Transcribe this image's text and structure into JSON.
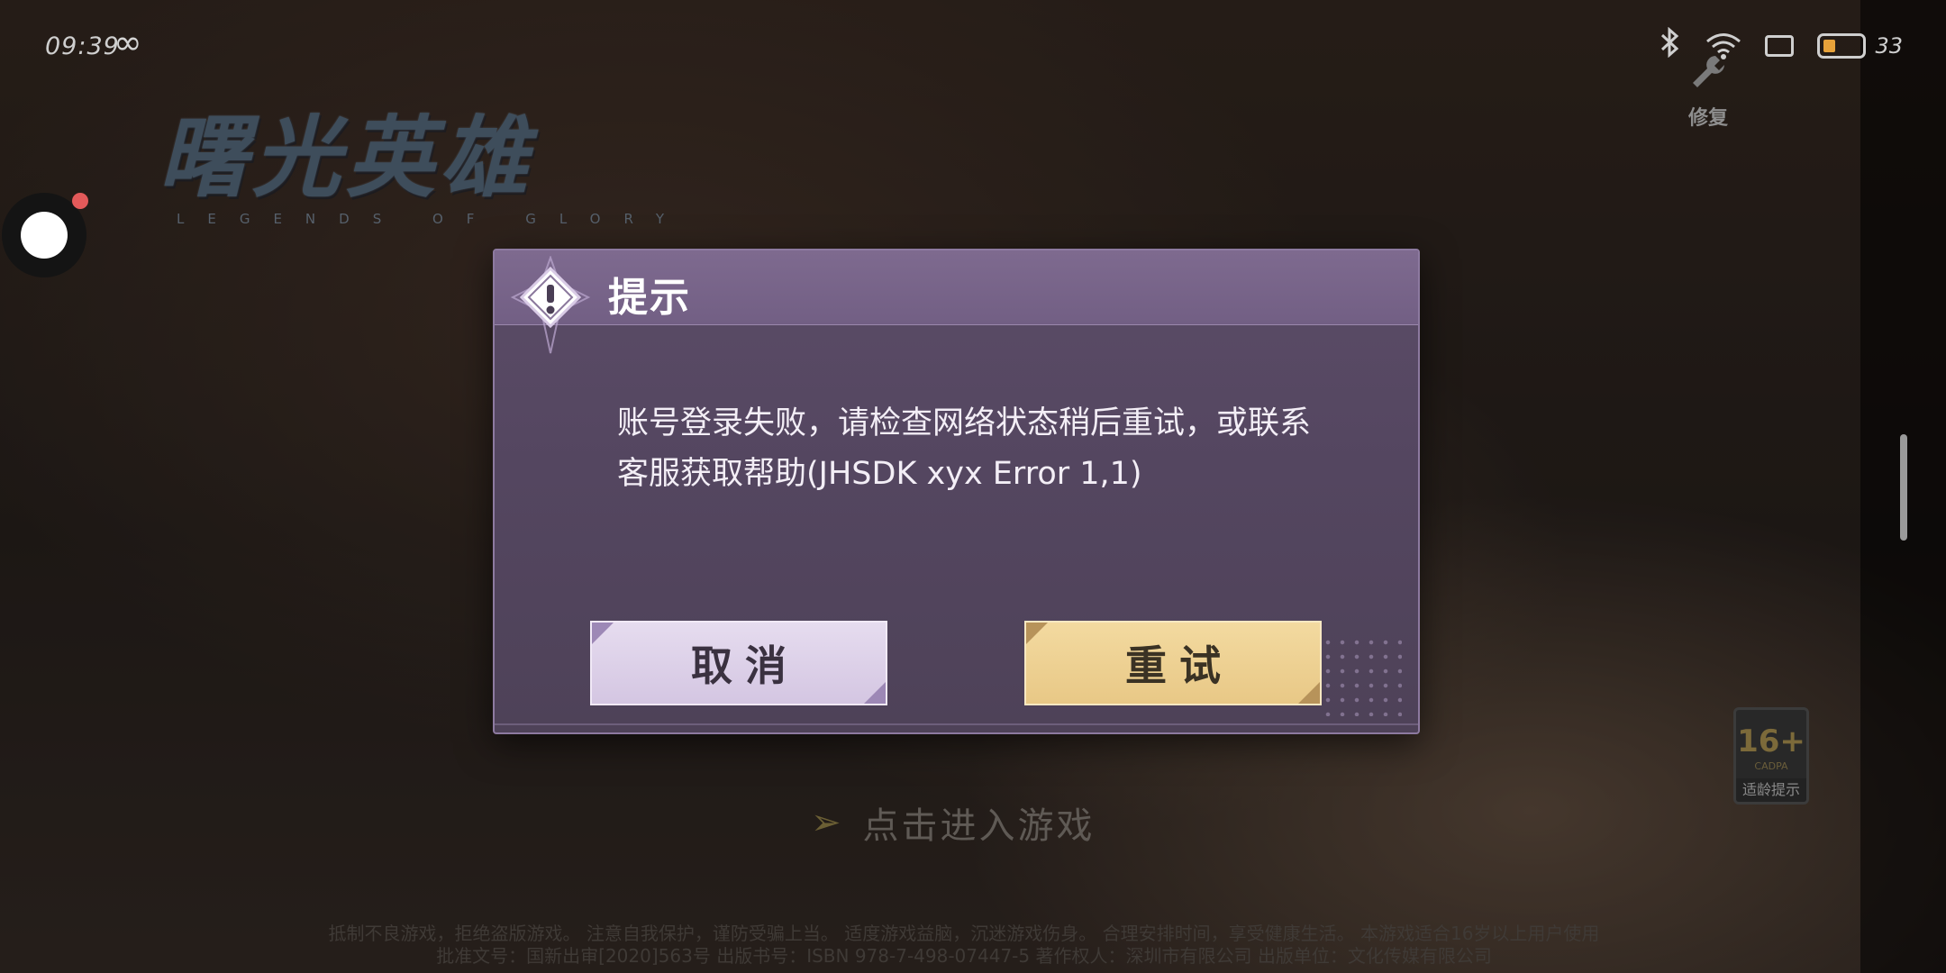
{
  "status_bar": {
    "time": "09:39",
    "infinity_icon": "∞",
    "bluetooth_icon": "bluetooth-icon",
    "wifi_icon": "wifi-icon",
    "screen_icon": "tablet-icon",
    "battery_level": "33",
    "battery_fraction": 0.33
  },
  "repair": {
    "label": "修复",
    "icon": "wrench-icon"
  },
  "logo": {
    "title": "曙光英雄",
    "subtitle": "LEGENDS OF GLORY"
  },
  "dialog": {
    "title": "提示",
    "message_line1": "账号登录失败，请检查网络状态稍后重试，或联系",
    "message_line2": "客服获取帮助(JHSDK xyx Error 1,1)",
    "cancel_label": "取消",
    "retry_label": "重试"
  },
  "enter_game": {
    "label": "点击进入游戏"
  },
  "age_rating": {
    "number": "16+",
    "org": "CADPA",
    "label": "适龄提示"
  },
  "legal": {
    "line1": "抵制不良游戏，拒绝盗版游戏。 注意自我保护，谨防受骗上当。 适度游戏益脑，沉迷游戏伤身。 合理安排时间，享受健康生活。 本游戏适合16岁以上用户使用",
    "line2": "批准文号：国新出审[2020]563号 出版书号：ISBN 978-7-498-07447-5 著作权人：深圳市有限公司 出版单位：文化传媒有限公司"
  },
  "colors": {
    "dialog_bg": "#544660",
    "dialog_header": "#7e6a8f",
    "cancel_button": "#ddd1e8",
    "retry_button": "#eed193",
    "battery": "#e8a23a"
  }
}
